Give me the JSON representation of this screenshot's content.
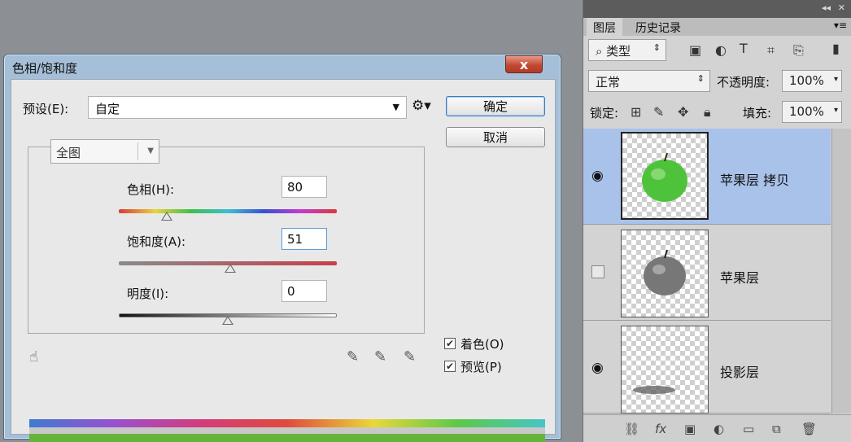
{
  "dialog": {
    "title": "色相/饱和度",
    "close_label": "x",
    "preset_label": "预设(E):",
    "preset_value": "自定",
    "ok_label": "确定",
    "cancel_label": "取消",
    "range_value": "全图",
    "hue": {
      "label": "色相(H):",
      "value": "80",
      "fraction": 0.22
    },
    "saturation": {
      "label": "饱和度(A):",
      "value": "51",
      "fraction": 0.51
    },
    "lightness": {
      "label": "明度(I):",
      "value": "0",
      "fraction": 0.5
    },
    "colorize": {
      "label": "着色(O)",
      "checked": true
    },
    "preview": {
      "label": "预览(P)",
      "checked": true
    }
  },
  "layers_panel": {
    "tabs": [
      "图层",
      "历史记录"
    ],
    "filter_value": "类型",
    "blend_mode": "正常",
    "opacity_label": "不透明度:",
    "opacity_value": "100%",
    "lock_label": "锁定:",
    "fill_label": "填充:",
    "fill_value": "100%",
    "layers": [
      {
        "name": "苹果层 拷贝",
        "visible": true,
        "selected": true
      },
      {
        "name": "苹果层",
        "visible": false,
        "selected": false
      },
      {
        "name": "投影层",
        "visible": true,
        "selected": false
      }
    ]
  },
  "icons": {
    "eye": "eye-icon",
    "gear": "gear-icon",
    "hand": "hand-icon",
    "link": "link-icon",
    "fx": "fx-icon",
    "trash": "trash-icon"
  },
  "colors": {
    "selected_row": "#a9c2ea",
    "apple_green": "#4fc23c",
    "dialog_frame": "#a6bfd8"
  }
}
